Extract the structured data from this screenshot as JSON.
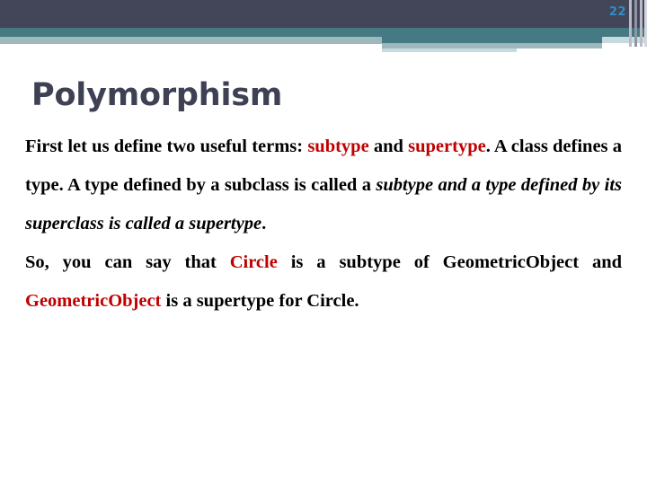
{
  "slide": {
    "page_number": "22",
    "title": "Polymorphism",
    "colors": {
      "header_dark": "#434559",
      "header_teal": "#467a82",
      "header_light": "#9db9bd",
      "header_pale": "#c7dade",
      "page_number": "#2f8fc4",
      "title": "#3e4053",
      "highlight_red": "#c00000",
      "body_text": "#000000",
      "background": "#ffffff"
    }
  },
  "body": {
    "paragraph_1": {
      "segments": [
        {
          "text": "First let us define two useful terms: ",
          "style": "plain"
        },
        {
          "text": "subtype",
          "style": "red"
        },
        {
          "text": " and ",
          "style": "plain"
        },
        {
          "text": "supertype",
          "style": "red"
        },
        {
          "text": ". A class defines a type. A type defined by a subclass is called a ",
          "style": "plain"
        },
        {
          "text": "subtype and a type defined by its superclass is called a supertype",
          "style": "italic"
        },
        {
          "text": ".",
          "style": "plain"
        }
      ],
      "plain_text": "First let us define two useful terms: subtype and supertype. A class defines a type. A type defined by a subclass is called a subtype and a type defined by its superclass is called a supertype."
    },
    "paragraph_2": {
      "segments": [
        {
          "text": "So, you can say that ",
          "style": "plain"
        },
        {
          "text": "Circle",
          "style": "red"
        },
        {
          "text": " is a subtype of GeometricObject and ",
          "style": "plain"
        },
        {
          "text": "GeometricObject",
          "style": "red"
        },
        {
          "text": " is a supertype for Circle.",
          "style": "plain"
        }
      ],
      "plain_text": "So, you can say that Circle is a subtype of GeometricObject and GeometricObject is a supertype for Circle."
    },
    "p1_a": "First let us define two useful terms: ",
    "p1_subtype": "subtype",
    "p1_b": " and ",
    "p1_supertype": "supertype",
    "p1_c": ". A class defines a type. A type defined by a subclass is called a ",
    "p1_italic": "subtype and a type defined by its superclass is called a supertype",
    "p1_d": ".",
    "p2_a": "So, you can say that ",
    "p2_circle": "Circle",
    "p2_b": " is a subtype of GeometricObject and ",
    "p2_geomobj": "GeometricObject",
    "p2_c": " is a supertype for Circle."
  }
}
